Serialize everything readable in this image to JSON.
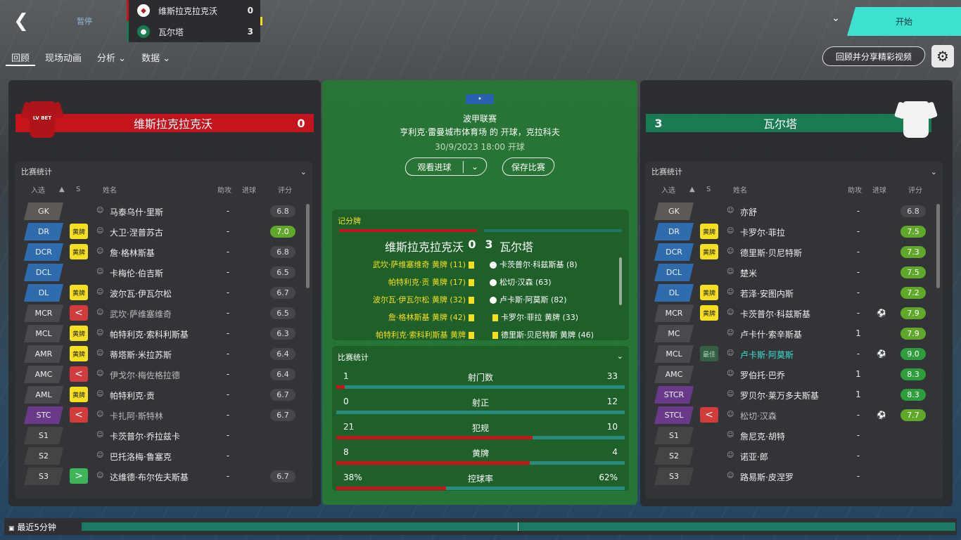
{
  "topbar": {
    "pause": "暂停",
    "start": "开始"
  },
  "score": {
    "home": {
      "name": "维斯拉克拉克沃",
      "goals": "0",
      "color": "#c4151c"
    },
    "away": {
      "name": "瓦尔塔",
      "goals": "3",
      "color": "#1a7a52"
    }
  },
  "tabs": [
    {
      "label": "回顾"
    },
    {
      "label": "现场动画"
    },
    {
      "label": "分析 ⌄"
    },
    {
      "label": "数据 ⌄"
    }
  ],
  "share_label": "回顾并分享精彩视频",
  "columns": {
    "sel": "入选",
    "s": "S",
    "name": "姓名",
    "assist": "助攻",
    "goal": "进球",
    "rating": "评分"
  },
  "stats_title": "比赛统计",
  "home": {
    "name": "维斯拉克拉克沃",
    "goals": "0",
    "sponsor": "LV BET",
    "players": [
      {
        "pos": "GK",
        "cls": "gk",
        "badge": "",
        "name": "马泰乌什·里斯",
        "assist": "-",
        "goal": "",
        "rating": "6.8",
        "rc": "r-n"
      },
      {
        "pos": "DR",
        "cls": "df",
        "badge": "黄牌",
        "bt": "yb",
        "name": "大卫·涅普苏古",
        "assist": "-",
        "goal": "",
        "rating": "7.0",
        "rc": "r-g"
      },
      {
        "pos": "DCR",
        "cls": "df",
        "badge": "黄牌",
        "bt": "yb",
        "name": "詹·格林斯基",
        "assist": "-",
        "goal": "",
        "rating": "6.8",
        "rc": "r-n"
      },
      {
        "pos": "DCL",
        "cls": "df",
        "badge": "",
        "name": "卡梅伦·伯吉斯",
        "assist": "-",
        "goal": "",
        "rating": "6.5",
        "rc": "r-n"
      },
      {
        "pos": "DL",
        "cls": "df",
        "badge": "黄牌",
        "bt": "yb",
        "name": "波尔瓦·伊瓦尔松",
        "assist": "-",
        "goal": "",
        "rating": "6.7",
        "rc": "r-n"
      },
      {
        "pos": "MCR",
        "cls": "mf",
        "badge": "<",
        "bt": "sub-off",
        "name": "武坎·萨维塞维奇",
        "out": true,
        "assist": "-",
        "goal": "",
        "rating": "6.5",
        "rc": "r-n"
      },
      {
        "pos": "MCL",
        "cls": "mf",
        "badge": "黄牌",
        "bt": "yb",
        "name": "帕特利克·索科利斯基",
        "assist": "-",
        "goal": "",
        "rating": "6.3",
        "rc": "r-n"
      },
      {
        "pos": "AMR",
        "cls": "mf",
        "badge": "黄牌",
        "bt": "yb",
        "name": "蒂塔斯·米拉苏斯",
        "assist": "-",
        "goal": "",
        "rating": "6.4",
        "rc": "r-n"
      },
      {
        "pos": "AMC",
        "cls": "mf",
        "badge": "<",
        "bt": "sub-off",
        "name": "伊戈尔·梅佐格拉德",
        "out": true,
        "assist": "-",
        "goal": "",
        "rating": "6.4",
        "rc": "r-n"
      },
      {
        "pos": "AML",
        "cls": "mf",
        "badge": "黄牌",
        "bt": "yb",
        "name": "帕特利克·贡",
        "assist": "-",
        "goal": "",
        "rating": "6.7",
        "rc": "r-n"
      },
      {
        "pos": "STC",
        "cls": "fw",
        "badge": "<",
        "bt": "sub-off",
        "name": "卡扎阿·斯特林",
        "out": true,
        "assist": "-",
        "goal": "",
        "rating": "6.7",
        "rc": "r-n"
      },
      {
        "pos": "S1",
        "cls": "sb",
        "badge": "",
        "name": "卡茨普尔·乔拉兹卡",
        "assist": "-",
        "goal": "",
        "rating": "",
        "rc": ""
      },
      {
        "pos": "S2",
        "cls": "sb",
        "badge": "",
        "name": "巴托洛梅·鲁塞克",
        "assist": "-",
        "goal": "",
        "rating": "",
        "rc": ""
      },
      {
        "pos": "S3",
        "cls": "sb",
        "badge": ">",
        "bt": "sub-on",
        "name": "达维德·布尔佐夫斯基",
        "assist": "-",
        "goal": "",
        "rating": "6.7",
        "rc": "r-n"
      }
    ]
  },
  "away": {
    "name": "瓦尔塔",
    "goals": "3",
    "players": [
      {
        "pos": "GK",
        "cls": "gk",
        "badge": "",
        "name": "亦舒",
        "assist": "-",
        "goal": "",
        "rating": "6.8",
        "rc": "r-n"
      },
      {
        "pos": "DR",
        "cls": "df",
        "badge": "黄牌",
        "bt": "yb",
        "name": "卡罗尔·菲拉",
        "assist": "-",
        "goal": "",
        "rating": "7.5",
        "rc": "r-g"
      },
      {
        "pos": "DCR",
        "cls": "df",
        "badge": "黄牌",
        "bt": "yb",
        "name": "德里斯·贝尼特斯",
        "assist": "-",
        "goal": "",
        "rating": "7.3",
        "rc": "r-g"
      },
      {
        "pos": "DCL",
        "cls": "df",
        "badge": "",
        "name": "楚米",
        "assist": "-",
        "goal": "",
        "rating": "7.5",
        "rc": "r-g"
      },
      {
        "pos": "DL",
        "cls": "df",
        "badge": "黄牌",
        "bt": "yb",
        "name": "若泽·安图内斯",
        "assist": "-",
        "goal": "",
        "rating": "7.2",
        "rc": "r-g"
      },
      {
        "pos": "MCR",
        "cls": "mf",
        "badge": "黄牌",
        "bt": "yb",
        "name": "卡茨普尔·科兹斯基",
        "assist": "-",
        "goal": "⚽",
        "rating": "7.9",
        "rc": "r-g"
      },
      {
        "pos": "MC",
        "cls": "mf",
        "badge": "",
        "name": "卢卡什·索辛斯基",
        "assist": "1",
        "goal": "",
        "rating": "7.9",
        "rc": "r-g"
      },
      {
        "pos": "MCL",
        "cls": "mf",
        "badge": "最佳",
        "bt": "potm",
        "name": "卢卡斯·阿莫斯",
        "star": true,
        "assist": "-",
        "goal": "⚽",
        "rating": "9.0",
        "rc": "r-gg"
      },
      {
        "pos": "AMC",
        "cls": "mf",
        "badge": "",
        "name": "罗伯托·巴乔",
        "assist": "1",
        "goal": "",
        "rating": "8.3",
        "rc": "r-gg"
      },
      {
        "pos": "STCR",
        "cls": "fw",
        "badge": "",
        "name": "罗贝尔·莱万多夫斯基",
        "assist": "1",
        "goal": "",
        "rating": "8.3",
        "rc": "r-gg"
      },
      {
        "pos": "STCL",
        "cls": "fw",
        "badge": "<",
        "bt": "sub-off",
        "name": "松切·汉森",
        "out": true,
        "assist": "-",
        "goal": "⚽",
        "rating": "7.7",
        "rc": "r-g"
      },
      {
        "pos": "S1",
        "cls": "sb",
        "badge": "",
        "name": "詹尼克·胡特",
        "assist": "-",
        "goal": "",
        "rating": "",
        "rc": ""
      },
      {
        "pos": "S2",
        "cls": "sb",
        "badge": "",
        "name": "诺亚·郎",
        "assist": "-",
        "goal": "",
        "rating": "",
        "rc": ""
      },
      {
        "pos": "S3",
        "cls": "sb",
        "badge": "",
        "name": "路易斯·皮涅罗",
        "assist": "-",
        "goal": "",
        "rating": "",
        "rc": ""
      }
    ]
  },
  "match": {
    "league": "波甲联赛",
    "venue": "亨利克·雷曼城市体育场 的 开球，克拉科夫",
    "date": "30/9/2023 18:00 开球",
    "watch": "观看进球",
    "save": "保存比赛"
  },
  "scoreboard": {
    "title": "记分牌",
    "home": "维斯拉克拉克沃",
    "home_goals": "0",
    "away_goals": "3",
    "away": "瓦尔塔",
    "home_events": [
      "武坎·萨维塞维奇 黄牌 (11)",
      "帕特利克·贡 黄牌 (17)",
      "波尔瓦·伊瓦尔松 黄牌 (32)",
      "詹·格林斯基 黄牌 (42)",
      "帕特利克·索科利斯基 黄牌"
    ],
    "away_events": [
      "卡茨普尔·科兹斯基 (8)",
      "松切·汉森 (63)",
      "卢卡斯·阿莫斯 (82)",
      "卡罗尔·菲拉 黄牌 (33)",
      "德里斯·贝尼特斯 黄牌 (46)"
    ]
  },
  "match_stats": [
    {
      "label": "射门数",
      "home": "1",
      "away": "33",
      "pct": 3
    },
    {
      "label": "射正",
      "home": "0",
      "away": "12",
      "pct": 0
    },
    {
      "label": "犯规",
      "home": "21",
      "away": "10",
      "pct": 68
    },
    {
      "label": "黄牌",
      "home": "8",
      "away": "4",
      "pct": 67
    },
    {
      "label": "控球率",
      "home": "38%",
      "away": "62%",
      "pct": 38
    }
  ],
  "bottom": {
    "label": "最近5分钟"
  }
}
